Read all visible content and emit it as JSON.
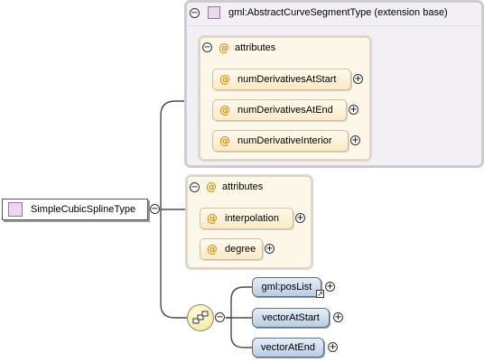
{
  "main_type": {
    "label": "SimpleCubicSplineType"
  },
  "extension_base": {
    "label": "gml:AbstractCurveSegmentType (extension base)",
    "attributes_label": "attributes",
    "attributes": [
      {
        "name": "numDerivativesAtStart"
      },
      {
        "name": "numDerivativesAtEnd"
      },
      {
        "name": "numDerivativeInterior"
      }
    ]
  },
  "own_attributes": {
    "label": "attributes",
    "attributes": [
      {
        "name": "interpolation"
      },
      {
        "name": "degree"
      }
    ]
  },
  "sequence": {
    "elements": [
      {
        "name": "gml:posList",
        "is_reference": true
      },
      {
        "name": "vectorAtStart",
        "is_reference": false
      },
      {
        "name": "vectorAtEnd",
        "is_reference": false
      }
    ]
  },
  "symbols": {
    "attribute_marker": "@",
    "collapse": "−",
    "expand": "+"
  },
  "colors": {
    "extension_box": "#f3f0f5",
    "attribute_box": "#fdf7e9",
    "element_pill": "#b9cce2",
    "attribute_marker": "#e0921a"
  }
}
